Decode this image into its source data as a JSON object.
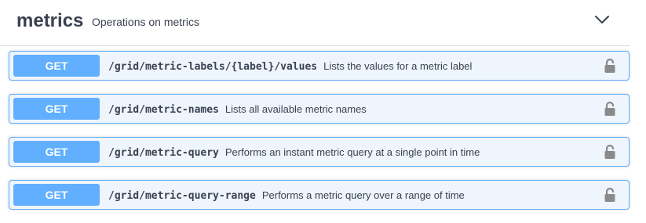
{
  "section": {
    "title": "metrics",
    "description": "Operations on metrics",
    "toggle_icon": "chevron-down-icon"
  },
  "colors": {
    "get_accent": "#61affe",
    "get_background": "#eef5fc",
    "text": "#3b4151",
    "lock": "#8a8a8a"
  },
  "operations": [
    {
      "method": "GET",
      "path": "/grid/metric-labels/{label}/values",
      "summary": "Lists the values for a metric label",
      "lock_icon": "lock-icon"
    },
    {
      "method": "GET",
      "path": "/grid/metric-names",
      "summary": "Lists all available metric names",
      "lock_icon": "lock-icon"
    },
    {
      "method": "GET",
      "path": "/grid/metric-query",
      "summary": "Performs an instant metric query at a single point in time",
      "lock_icon": "lock-icon"
    },
    {
      "method": "GET",
      "path": "/grid/metric-query-range",
      "summary": "Performs a metric query over a range of time",
      "lock_icon": "lock-icon"
    }
  ]
}
